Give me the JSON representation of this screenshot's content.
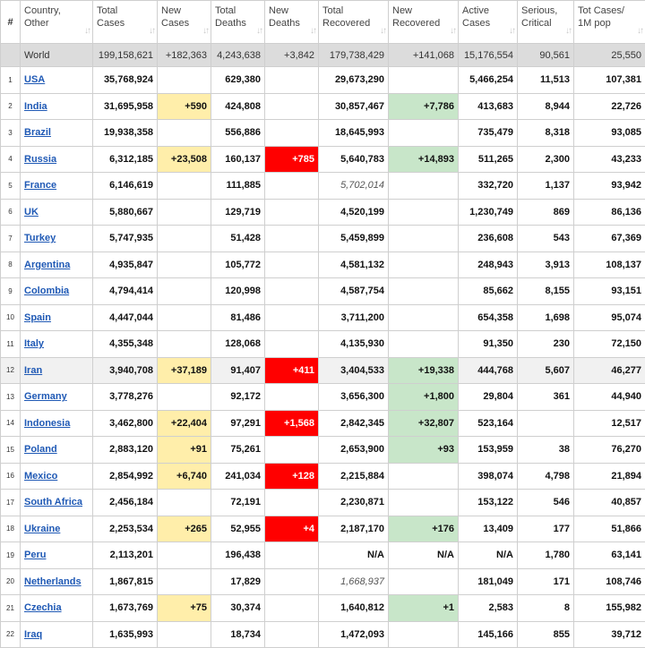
{
  "headers": [
    {
      "label": "#",
      "sortable": false
    },
    {
      "label": "Country,\nOther",
      "sortable": true
    },
    {
      "label": "Total\nCases",
      "sortable": true
    },
    {
      "label": "New\nCases",
      "sortable": true
    },
    {
      "label": "Total\nDeaths",
      "sortable": true
    },
    {
      "label": "New\nDeaths",
      "sortable": true
    },
    {
      "label": "Total\nRecovered",
      "sortable": true
    },
    {
      "label": "New\nRecovered",
      "sortable": true
    },
    {
      "label": "Active\nCases",
      "sortable": true
    },
    {
      "label": "Serious,\nCritical",
      "sortable": true
    },
    {
      "label": "Tot Cases/\n1M pop",
      "sortable": true
    }
  ],
  "sort_icon": "sort-arrows-icon",
  "colors": {
    "new_cases_highlight": "#ffeeaa",
    "new_deaths_highlight": "#ff0000",
    "new_recovered_highlight": "#c8e6c9",
    "link": "#1f59b5",
    "world_row": "#dcdcdc"
  },
  "world": {
    "name": "World",
    "total_cases": "199,158,621",
    "new_cases": "+182,363",
    "total_deaths": "4,243,638",
    "new_deaths": "+3,842",
    "total_recovered": "179,738,429",
    "new_recovered": "+141,068",
    "active_cases": "15,176,554",
    "serious_critical": "90,561",
    "tot_cases_1m": "25,550"
  },
  "rows": [
    {
      "idx": "1",
      "country": "USA",
      "total_cases": "35,768,924",
      "new_cases": "",
      "total_deaths": "629,380",
      "new_deaths": "",
      "total_recovered": "29,673,290",
      "new_recovered": "",
      "active_cases": "5,466,254",
      "serious_critical": "11,513",
      "tot_cases_1m": "107,381"
    },
    {
      "idx": "2",
      "country": "India",
      "total_cases": "31,695,958",
      "new_cases": "+590",
      "total_deaths": "424,808",
      "new_deaths": "",
      "total_recovered": "30,857,467",
      "new_recovered": "+7,786",
      "active_cases": "413,683",
      "serious_critical": "8,944",
      "tot_cases_1m": "22,726"
    },
    {
      "idx": "3",
      "country": "Brazil",
      "total_cases": "19,938,358",
      "new_cases": "",
      "total_deaths": "556,886",
      "new_deaths": "",
      "total_recovered": "18,645,993",
      "new_recovered": "",
      "active_cases": "735,479",
      "serious_critical": "8,318",
      "tot_cases_1m": "93,085"
    },
    {
      "idx": "4",
      "country": "Russia",
      "total_cases": "6,312,185",
      "new_cases": "+23,508",
      "total_deaths": "160,137",
      "new_deaths": "+785",
      "total_recovered": "5,640,783",
      "new_recovered": "+14,893",
      "active_cases": "511,265",
      "serious_critical": "2,300",
      "tot_cases_1m": "43,233"
    },
    {
      "idx": "5",
      "country": "France",
      "total_cases": "6,146,619",
      "new_cases": "",
      "total_deaths": "111,885",
      "new_deaths": "",
      "total_recovered": "5,702,014",
      "new_recovered": "",
      "active_cases": "332,720",
      "serious_critical": "1,137",
      "tot_cases_1m": "93,942",
      "recovered_italic": true
    },
    {
      "idx": "6",
      "country": "UK",
      "total_cases": "5,880,667",
      "new_cases": "",
      "total_deaths": "129,719",
      "new_deaths": "",
      "total_recovered": "4,520,199",
      "new_recovered": "",
      "active_cases": "1,230,749",
      "serious_critical": "869",
      "tot_cases_1m": "86,136"
    },
    {
      "idx": "7",
      "country": "Turkey",
      "total_cases": "5,747,935",
      "new_cases": "",
      "total_deaths": "51,428",
      "new_deaths": "",
      "total_recovered": "5,459,899",
      "new_recovered": "",
      "active_cases": "236,608",
      "serious_critical": "543",
      "tot_cases_1m": "67,369"
    },
    {
      "idx": "8",
      "country": "Argentina",
      "total_cases": "4,935,847",
      "new_cases": "",
      "total_deaths": "105,772",
      "new_deaths": "",
      "total_recovered": "4,581,132",
      "new_recovered": "",
      "active_cases": "248,943",
      "serious_critical": "3,913",
      "tot_cases_1m": "108,137"
    },
    {
      "idx": "9",
      "country": "Colombia",
      "total_cases": "4,794,414",
      "new_cases": "",
      "total_deaths": "120,998",
      "new_deaths": "",
      "total_recovered": "4,587,754",
      "new_recovered": "",
      "active_cases": "85,662",
      "serious_critical": "8,155",
      "tot_cases_1m": "93,151"
    },
    {
      "idx": "10",
      "country": "Spain",
      "total_cases": "4,447,044",
      "new_cases": "",
      "total_deaths": "81,486",
      "new_deaths": "",
      "total_recovered": "3,711,200",
      "new_recovered": "",
      "active_cases": "654,358",
      "serious_critical": "1,698",
      "tot_cases_1m": "95,074"
    },
    {
      "idx": "11",
      "country": "Italy",
      "total_cases": "4,355,348",
      "new_cases": "",
      "total_deaths": "128,068",
      "new_deaths": "",
      "total_recovered": "4,135,930",
      "new_recovered": "",
      "active_cases": "91,350",
      "serious_critical": "230",
      "tot_cases_1m": "72,150"
    },
    {
      "idx": "12",
      "country": "Iran",
      "total_cases": "3,940,708",
      "new_cases": "+37,189",
      "total_deaths": "91,407",
      "new_deaths": "+411",
      "total_recovered": "3,404,533",
      "new_recovered": "+19,338",
      "active_cases": "444,768",
      "serious_critical": "5,607",
      "tot_cases_1m": "46,277",
      "highlighted": true
    },
    {
      "idx": "13",
      "country": "Germany",
      "total_cases": "3,778,276",
      "new_cases": "",
      "total_deaths": "92,172",
      "new_deaths": "",
      "total_recovered": "3,656,300",
      "new_recovered": "+1,800",
      "active_cases": "29,804",
      "serious_critical": "361",
      "tot_cases_1m": "44,940"
    },
    {
      "idx": "14",
      "country": "Indonesia",
      "total_cases": "3,462,800",
      "new_cases": "+22,404",
      "total_deaths": "97,291",
      "new_deaths": "+1,568",
      "total_recovered": "2,842,345",
      "new_recovered": "+32,807",
      "active_cases": "523,164",
      "serious_critical": "",
      "tot_cases_1m": "12,517"
    },
    {
      "idx": "15",
      "country": "Poland",
      "total_cases": "2,883,120",
      "new_cases": "+91",
      "total_deaths": "75,261",
      "new_deaths": "",
      "total_recovered": "2,653,900",
      "new_recovered": "+93",
      "active_cases": "153,959",
      "serious_critical": "38",
      "tot_cases_1m": "76,270"
    },
    {
      "idx": "16",
      "country": "Mexico",
      "total_cases": "2,854,992",
      "new_cases": "+6,740",
      "total_deaths": "241,034",
      "new_deaths": "+128",
      "total_recovered": "2,215,884",
      "new_recovered": "",
      "active_cases": "398,074",
      "serious_critical": "4,798",
      "tot_cases_1m": "21,894"
    },
    {
      "idx": "17",
      "country": "South Africa",
      "total_cases": "2,456,184",
      "new_cases": "",
      "total_deaths": "72,191",
      "new_deaths": "",
      "total_recovered": "2,230,871",
      "new_recovered": "",
      "active_cases": "153,122",
      "serious_critical": "546",
      "tot_cases_1m": "40,857"
    },
    {
      "idx": "18",
      "country": "Ukraine",
      "total_cases": "2,253,534",
      "new_cases": "+265",
      "total_deaths": "52,955",
      "new_deaths": "+4",
      "total_recovered": "2,187,170",
      "new_recovered": "+176",
      "active_cases": "13,409",
      "serious_critical": "177",
      "tot_cases_1m": "51,866"
    },
    {
      "idx": "19",
      "country": "Peru",
      "total_cases": "2,113,201",
      "new_cases": "",
      "total_deaths": "196,438",
      "new_deaths": "",
      "total_recovered": "N/A",
      "new_recovered": "N/A",
      "active_cases": "N/A",
      "serious_critical": "1,780",
      "tot_cases_1m": "63,141",
      "na_plain": true
    },
    {
      "idx": "20",
      "country": "Netherlands",
      "total_cases": "1,867,815",
      "new_cases": "",
      "total_deaths": "17,829",
      "new_deaths": "",
      "total_recovered": "1,668,937",
      "new_recovered": "",
      "active_cases": "181,049",
      "serious_critical": "171",
      "tot_cases_1m": "108,746",
      "recovered_italic": true
    },
    {
      "idx": "21",
      "country": "Czechia",
      "total_cases": "1,673,769",
      "new_cases": "+75",
      "total_deaths": "30,374",
      "new_deaths": "",
      "total_recovered": "1,640,812",
      "new_recovered": "+1",
      "active_cases": "2,583",
      "serious_critical": "8",
      "tot_cases_1m": "155,982"
    },
    {
      "idx": "22",
      "country": "Iraq",
      "total_cases": "1,635,993",
      "new_cases": "",
      "total_deaths": "18,734",
      "new_deaths": "",
      "total_recovered": "1,472,093",
      "new_recovered": "",
      "active_cases": "145,166",
      "serious_critical": "855",
      "tot_cases_1m": "39,712"
    }
  ]
}
